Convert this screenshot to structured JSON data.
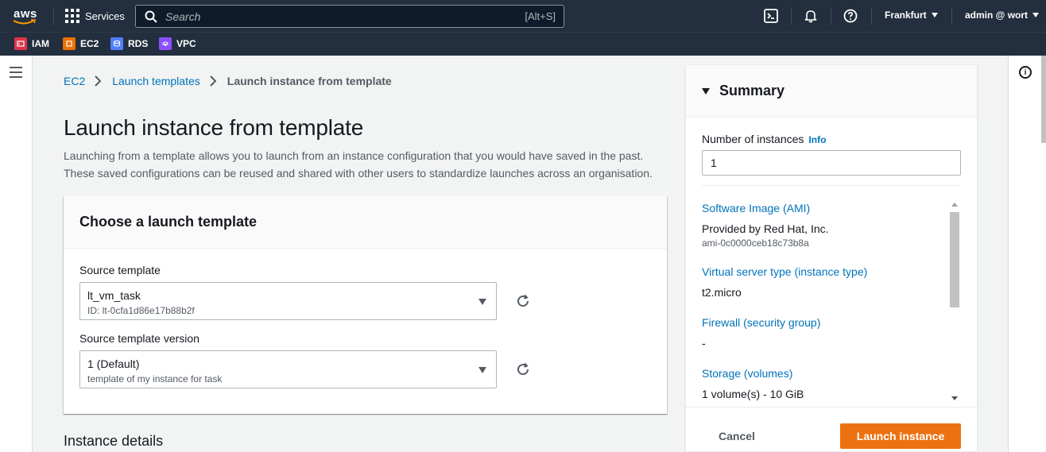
{
  "nav": {
    "logo_text": "aws",
    "services_label": "Services",
    "search_placeholder": "Search",
    "search_shortcut": "[Alt+S]",
    "region": "Frankfurt",
    "account": "admin @ wort"
  },
  "favorites": [
    {
      "label": "IAM",
      "color": "#dd344c"
    },
    {
      "label": "EC2",
      "color": "#ed7100"
    },
    {
      "label": "RDS",
      "color": "#527fff"
    },
    {
      "label": "VPC",
      "color": "#8c4fff"
    }
  ],
  "breadcrumb": {
    "items": [
      "EC2",
      "Launch templates"
    ],
    "current": "Launch instance from template"
  },
  "page": {
    "title": "Launch instance from template",
    "description": "Launching from a template allows you to launch from an instance configuration that you would have saved in the past. These saved configurations can be reused and shared with other users to standardize launches across an organisation."
  },
  "template_card": {
    "header": "Choose a launch template",
    "source_label": "Source template",
    "source_value": "lt_vm_task",
    "source_id": "ID: lt-0cfa1d86e17b88b2f",
    "version_label": "Source template version",
    "version_value": "1 (Default)",
    "version_desc": "template of my instance for task"
  },
  "next_section": "Instance details",
  "summary": {
    "title": "Summary",
    "num_label": "Number of instances",
    "info_link": "Info",
    "num_value": "1",
    "ami_title": "Software Image (AMI)",
    "ami_provider": "Provided by Red Hat, Inc.",
    "ami_id": "ami-0c0000ceb18c73b8a",
    "type_title": "Virtual server type (instance type)",
    "type_value": "t2.micro",
    "firewall_title": "Firewall (security group)",
    "firewall_value": "-",
    "storage_title": "Storage (volumes)",
    "storage_value": "1 volume(s) - 10 GiB",
    "cancel_label": "Cancel",
    "launch_label": "Launch instance"
  },
  "colors": {
    "nav_bg": "#232f3e",
    "link": "#0073bb",
    "primary_button": "#ec7211"
  }
}
